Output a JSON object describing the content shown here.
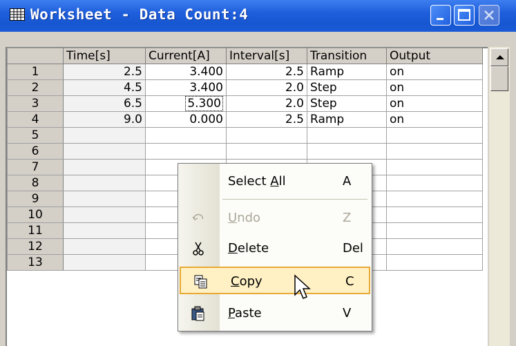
{
  "window": {
    "title": "Worksheet - Data Count:4"
  },
  "columns": [
    "Time[s]",
    "Current[A]",
    "Interval[s]",
    "Transition",
    "Output"
  ],
  "rows": [
    {
      "num": "1",
      "time": "2.5",
      "current": "3.400",
      "interval": "2.5",
      "transition": "Ramp",
      "output": "on"
    },
    {
      "num": "2",
      "time": "4.5",
      "current": "3.400",
      "interval": "2.0",
      "transition": "Step",
      "output": "on"
    },
    {
      "num": "3",
      "time": "6.5",
      "current": "5.300",
      "interval": "2.0",
      "transition": "Step",
      "output": "on"
    },
    {
      "num": "4",
      "time": "9.0",
      "current": "0.000",
      "interval": "2.5",
      "transition": "Ramp",
      "output": "on"
    }
  ],
  "empty_rows": [
    "5",
    "6",
    "7",
    "8",
    "9",
    "10",
    "11",
    "12",
    "13"
  ],
  "context_menu": {
    "select_all": {
      "pre": "Select ",
      "mnemonic": "A",
      "post": "ll",
      "key": "A"
    },
    "undo": {
      "pre": "",
      "mnemonic": "U",
      "post": "ndo",
      "key": "Z"
    },
    "delete": {
      "pre": "",
      "mnemonic": "D",
      "post": "elete",
      "key": "Del"
    },
    "copy": {
      "pre": "",
      "mnemonic": "C",
      "post": "opy",
      "key": "C"
    },
    "paste": {
      "pre": "",
      "mnemonic": "P",
      "post": "aste",
      "key": "V"
    }
  },
  "colors": {
    "titlebar": "#1f5fdc",
    "menu_highlight": "#fff1c4",
    "menu_highlight_border": "#e8a936"
  },
  "icons": {
    "title": "grid-icon",
    "undo": "undo-icon",
    "delete": "scissors-icon",
    "copy": "copy-icon",
    "paste": "clipboard-icon"
  }
}
